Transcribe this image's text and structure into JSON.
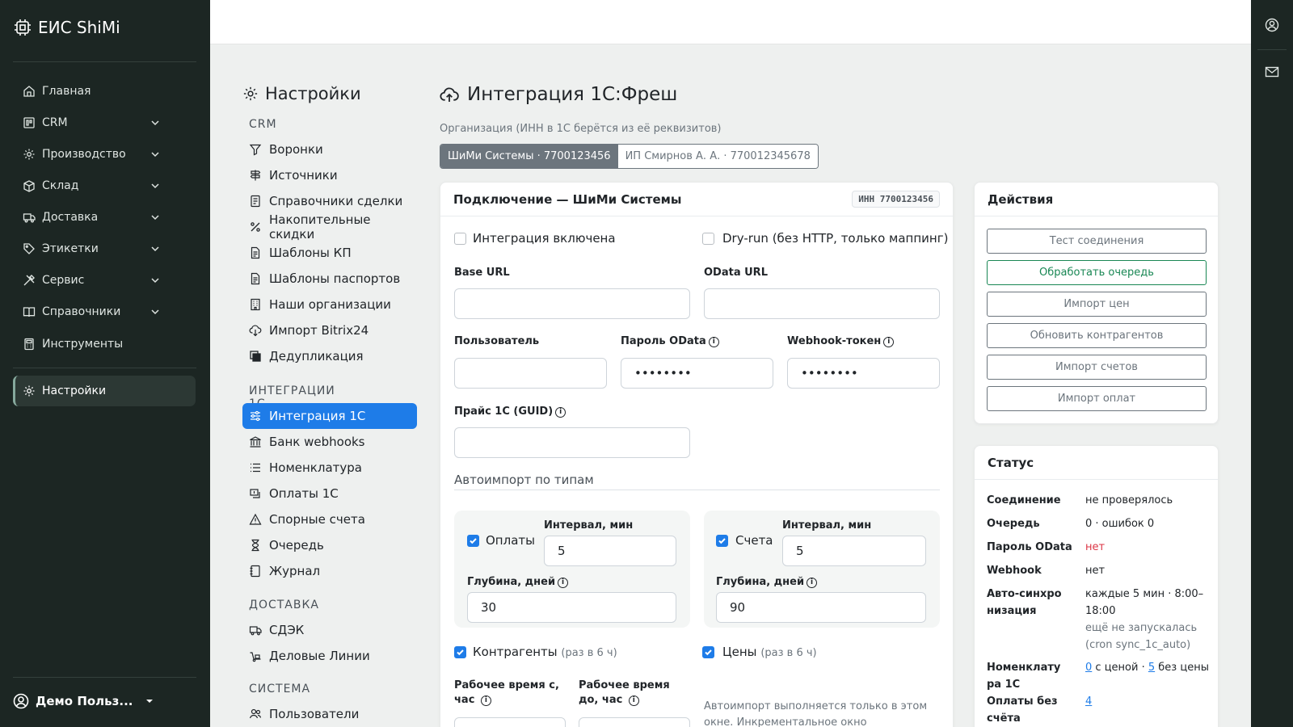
{
  "app": {
    "title": "ЕИС ShiMi"
  },
  "sidebar": {
    "items": [
      {
        "label": "Главная",
        "icon": "home-icon"
      },
      {
        "label": "CRM",
        "icon": "crm-icon"
      },
      {
        "label": "Производство",
        "icon": "gear-icon"
      },
      {
        "label": "Склад",
        "icon": "box-icon"
      },
      {
        "label": "Доставка",
        "icon": "truck-icon"
      },
      {
        "label": "Этикетки",
        "icon": "tag-icon"
      },
      {
        "label": "Сервис",
        "icon": "tools-icon"
      },
      {
        "label": "Справочники",
        "icon": "book-icon"
      },
      {
        "label": "Инструменты",
        "icon": "calculator-icon"
      }
    ],
    "active": {
      "label": "Настройки",
      "icon": "gear-icon"
    },
    "user": "Демо Польз..."
  },
  "settings_nav": {
    "title": "Настройки",
    "sections": [
      {
        "name": "CRM",
        "items": [
          "Воронки",
          "Источники",
          "Справочники сделки",
          "Накопительные скидки",
          "Шаблоны КП",
          "Шаблоны паспортов",
          "Наши организации",
          "Импорт Bitrix24",
          "Дедупликация"
        ]
      },
      {
        "name": "ИНТЕГРАЦИИ 1С",
        "items": [
          "Интеграция 1С",
          "Банк webhooks",
          "Номенклатура",
          "Оплаты 1С",
          "Спорные счета",
          "Очередь",
          "Журнал"
        ]
      },
      {
        "name": "ДОСТАВКА",
        "items": [
          "СДЭК",
          "Деловые Линии"
        ]
      },
      {
        "name": "СИСТЕМА",
        "items": [
          "Пользователи"
        ]
      }
    ]
  },
  "main": {
    "title": "Интеграция 1С:Фреш",
    "org_label": "Организация (ИНН в 1С берётся из её реквизитов)",
    "orgs": [
      {
        "label": "ШиМи Системы · 7700123456",
        "selected": true
      },
      {
        "label": "ИП Смирнов А. А. · 770012345678",
        "selected": false
      }
    ],
    "connection": {
      "title": "Подключение — ШиМи Системы",
      "inn_badge": "ИНН 7700123456",
      "integration_enabled_label": "Интеграция включена",
      "dry_run_label": "Dry-run (без HTTP, только маппинг)",
      "base_url_label": "Base URL",
      "base_url_value": "",
      "odata_url_label": "OData URL",
      "odata_url_value": "",
      "user_label": "Пользователь",
      "user_value": "",
      "odata_password_label": "Пароль OData",
      "odata_password_value": "••••••••",
      "webhook_token_label": "Webhook-токен",
      "webhook_token_value": "••••••••",
      "price_label": "Прайс 1С (GUID)",
      "price_value": "",
      "autoimport_title": "Автоимпорт по типам",
      "payments": {
        "label": "Оплаты",
        "checked": true,
        "interval_label": "Интервал, мин",
        "interval": "5",
        "depth_label": "Глубина, дней",
        "depth": "30"
      },
      "invoices": {
        "label": "Счета",
        "checked": true,
        "interval_label": "Интервал, мин",
        "interval": "5",
        "depth_label": "Глубина, дней",
        "depth": "90"
      },
      "contractors": {
        "label": "Контрагенты",
        "note": "(раз в 6 ч)",
        "checked": true
      },
      "prices": {
        "label": "Цены",
        "note": "(раз в 6 ч)",
        "checked": true
      },
      "work_from_label": "Рабочее время с, час",
      "work_to_label": "Рабочее время до, час",
      "autoimport_note": "Автоимпорт выполняется только в этом окне. Инкрементальное окно последующих синков"
    },
    "actions": {
      "title": "Действия",
      "buttons": [
        "Тест соединения",
        "Обработать очередь",
        "Импорт цен",
        "Обновить контрагентов",
        "Импорт счетов",
        "Импорт оплат"
      ]
    },
    "status": {
      "title": "Статус",
      "connection_k": "Соединение",
      "connection_v": "не проверялось",
      "queue_k": "Очередь",
      "queue_v": "0 · ошибок 0",
      "odata_k": "Пароль OData",
      "odata_v": "нет",
      "webhook_k": "Webhook",
      "webhook_v": "нет",
      "autosync_k": "Авто-синхронизация",
      "autosync_v": "каждые 5 мин · 8:00–18:00",
      "autosync_note": "ещё не запускалась (cron sync_1c_auto)",
      "nomen_k": "Номенклатура 1С",
      "nomen_with": "0",
      "nomen_with_text": "с ценой ·",
      "nomen_without": "5",
      "nomen_without_text": "без цены",
      "unbilled_k": "Оплаты без счёта",
      "unbilled_v": "4"
    }
  },
  "colors": {
    "sidebar_bg": "#1c2623",
    "accent": "#1e7ce8",
    "success": "#198754",
    "danger": "#dc3545"
  }
}
